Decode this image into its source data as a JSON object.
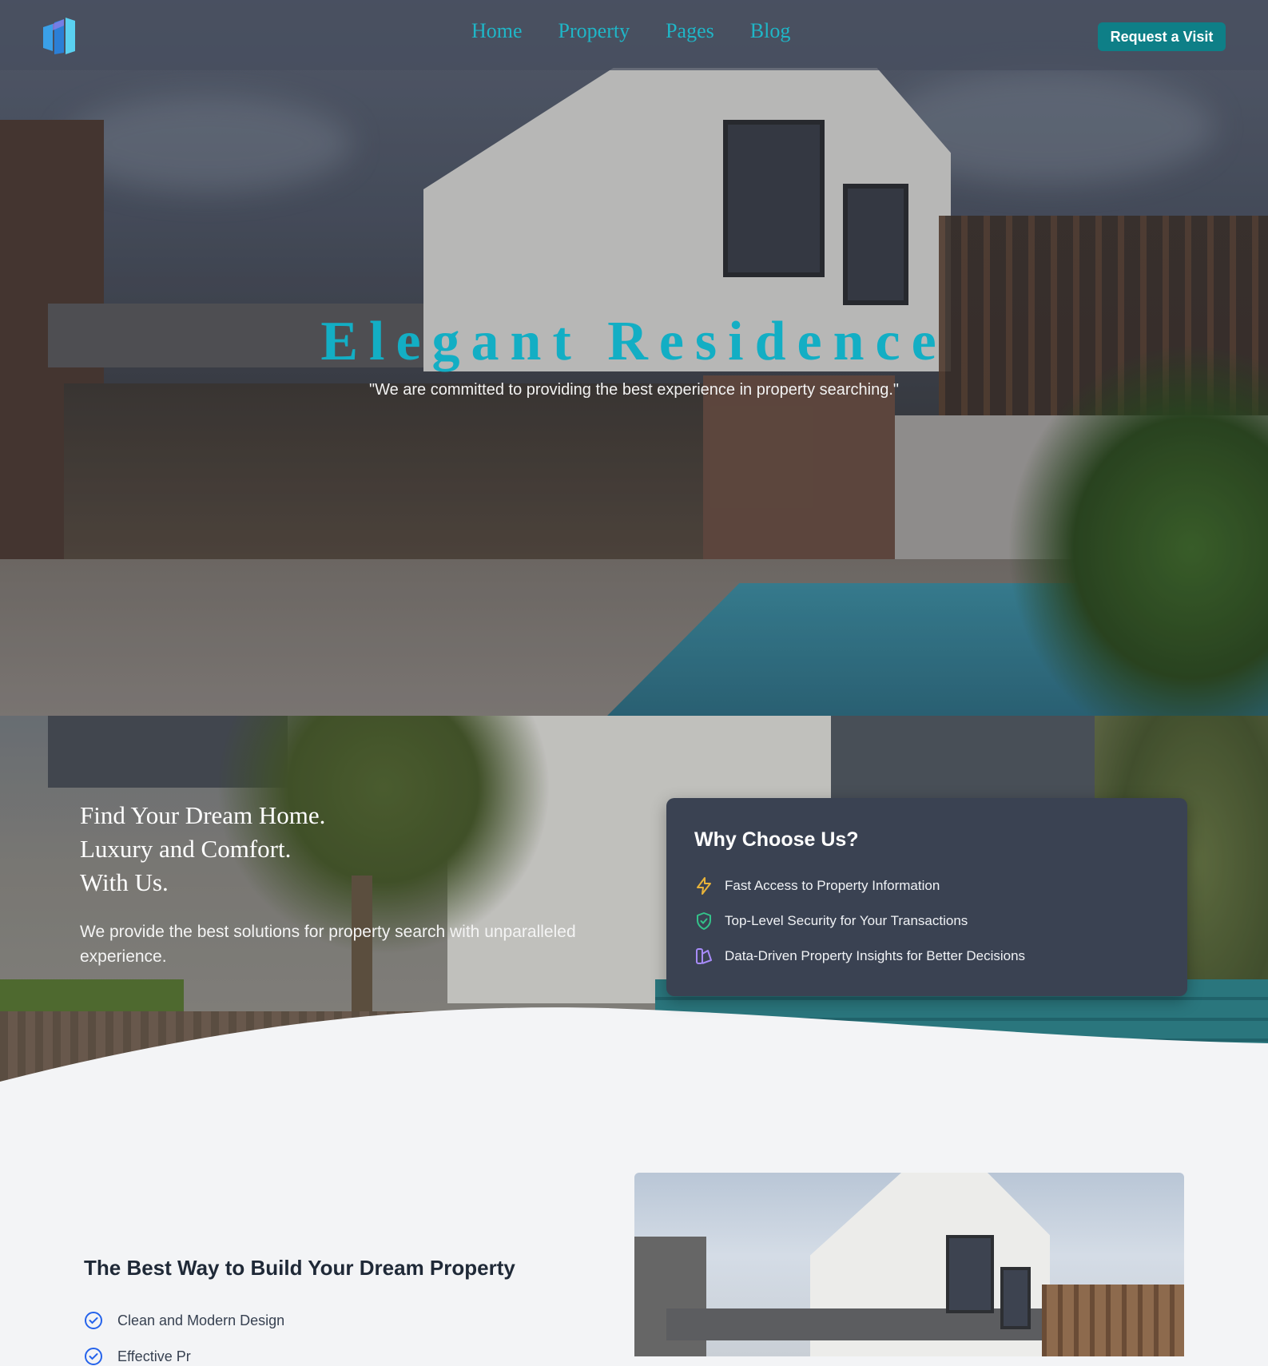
{
  "nav": {
    "links": [
      "Home",
      "Property",
      "Pages",
      "Blog"
    ],
    "cta": "Request a Visit"
  },
  "hero": {
    "title": "Elegant Residence",
    "subtitle": "\"We are committed to providing the best experience in property searching.\""
  },
  "intro": {
    "headline": [
      "Find Your Dream Home.",
      "Luxury and Comfort.",
      "With Us."
    ],
    "description": "We provide the best solutions for property search with unparalleled experience."
  },
  "why": {
    "title": "Why Choose Us?",
    "items": [
      {
        "icon": "lightning-icon",
        "text": "Fast Access to Property Information"
      },
      {
        "icon": "shield-check-icon",
        "text": "Top-Level Security for Your Transactions"
      },
      {
        "icon": "chart-icon",
        "text": "Data-Driven Property Insights for Better Decisions"
      }
    ]
  },
  "build": {
    "title": "The Best Way to Build Your Dream Property",
    "features": [
      "Clean and Modern Design",
      "Effective Pr"
    ]
  },
  "colors": {
    "accent": "#13aec4",
    "cta": "#0e7f87",
    "card": "#3a4252",
    "page_bg": "#f3f4f6"
  }
}
